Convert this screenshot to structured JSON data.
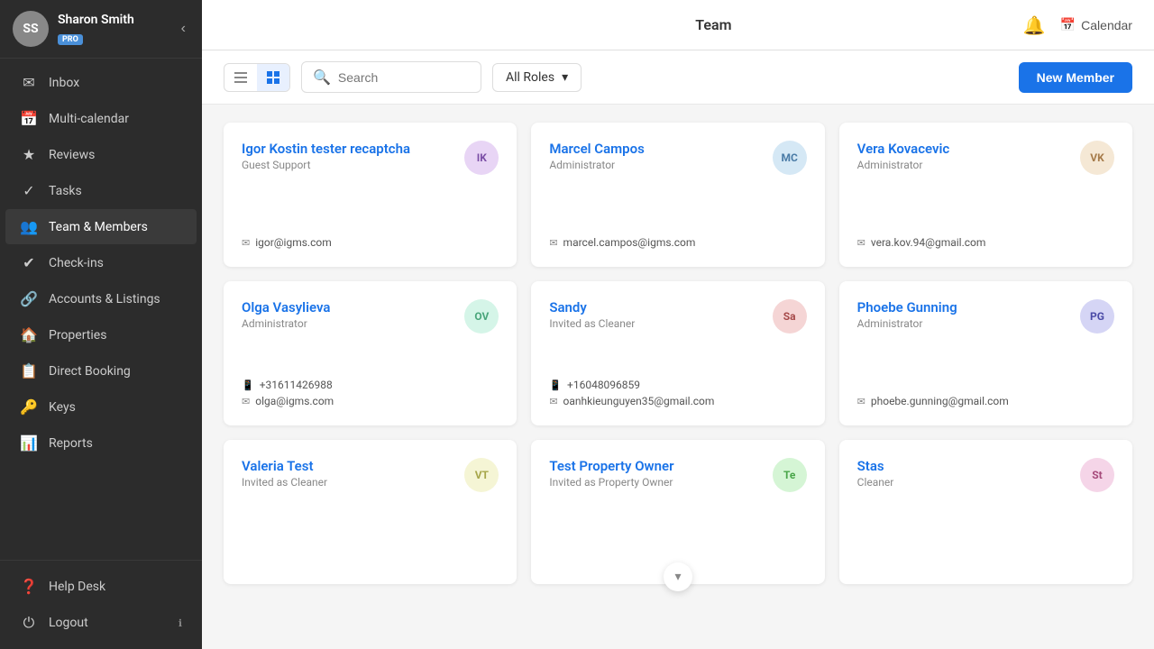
{
  "sidebar": {
    "profile": {
      "name": "Sharon Smith",
      "badge": "PRO",
      "initials": "SS"
    },
    "items": [
      {
        "id": "inbox",
        "label": "Inbox",
        "icon": "✉"
      },
      {
        "id": "multi-calendar",
        "label": "Multi-calendar",
        "icon": "📅"
      },
      {
        "id": "reviews",
        "label": "Reviews",
        "icon": "★"
      },
      {
        "id": "tasks",
        "label": "Tasks",
        "icon": "✓"
      },
      {
        "id": "team",
        "label": "Team & Members",
        "icon": "👥"
      },
      {
        "id": "checkins",
        "label": "Check-ins",
        "icon": "✔"
      },
      {
        "id": "accounts",
        "label": "Accounts & Listings",
        "icon": "🔗"
      },
      {
        "id": "properties",
        "label": "Properties",
        "icon": "🏠"
      },
      {
        "id": "direct-booking",
        "label": "Direct Booking",
        "icon": "📋"
      },
      {
        "id": "keys",
        "label": "Keys",
        "icon": "🔑"
      },
      {
        "id": "reports",
        "label": "Reports",
        "icon": "📊"
      }
    ],
    "bottom": [
      {
        "id": "helpdesk",
        "label": "Help Desk",
        "icon": "?"
      },
      {
        "id": "logout",
        "label": "Logout",
        "icon": "⏻"
      }
    ]
  },
  "header": {
    "title": "Team",
    "bell_label": "Notifications",
    "calendar_label": "Calendar"
  },
  "toolbar": {
    "search_placeholder": "Search",
    "roles_label": "All Roles",
    "new_member_label": "New Member"
  },
  "members": [
    {
      "id": 1,
      "name": "Igor Kostin tester recaptcha",
      "role": "Guest Support",
      "initials": "IK",
      "av_class": "av-ik",
      "email": "igor@igms.com",
      "phone": null
    },
    {
      "id": 2,
      "name": "Marcel Campos",
      "role": "Administrator",
      "initials": "MC",
      "av_class": "av-mc",
      "email": "marcel.campos@igms.com",
      "phone": null
    },
    {
      "id": 3,
      "name": "Vera Kovacevic",
      "role": "Administrator",
      "initials": "VK",
      "av_class": "av-vk",
      "email": "vera.kov.94@gmail.com",
      "phone": null
    },
    {
      "id": 4,
      "name": "Olga Vasylieva",
      "role": "Administrator",
      "initials": "OV",
      "av_class": "av-ov",
      "email": "olga@igms.com",
      "phone": "+31611426988"
    },
    {
      "id": 5,
      "name": "Sandy",
      "role": "Invited as Cleaner",
      "initials": "Sa",
      "av_class": "av-sa",
      "email": "oanhkieunguyen35@gmail.com",
      "phone": "+16048096859"
    },
    {
      "id": 6,
      "name": "Phoebe Gunning",
      "role": "Administrator",
      "initials": "PG",
      "av_class": "av-pg",
      "email": "phoebe.gunning@gmail.com",
      "phone": null
    },
    {
      "id": 7,
      "name": "Valeria Test",
      "role": "Invited as Cleaner",
      "initials": "VT",
      "av_class": "av-vt",
      "email": null,
      "phone": null
    },
    {
      "id": 8,
      "name": "Test Property Owner",
      "role": "Invited as Property Owner",
      "initials": "Te",
      "av_class": "av-te",
      "email": null,
      "phone": null
    },
    {
      "id": 9,
      "name": "Stas",
      "role": "Cleaner",
      "initials": "St",
      "av_class": "av-st",
      "email": null,
      "phone": null
    }
  ]
}
